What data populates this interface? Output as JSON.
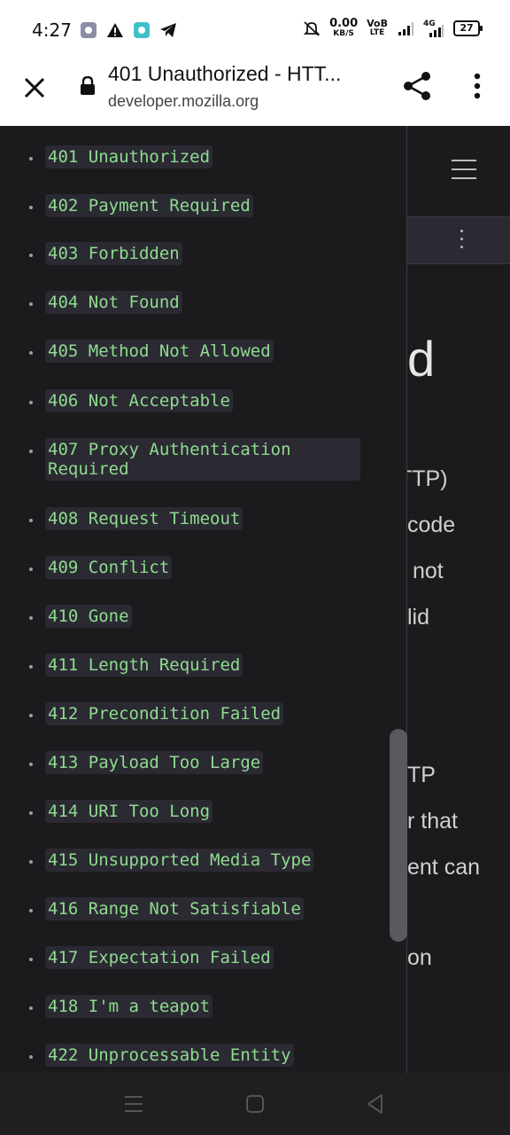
{
  "status_bar": {
    "time": "4:27",
    "net_speed_value": "0.00",
    "net_speed_unit": "KB/S",
    "volte_top": "VoB",
    "volte_bottom": "LTE",
    "network_label": "4G",
    "battery_level": "27",
    "left_icons": [
      "app-icon",
      "warning-icon",
      "app-icon",
      "telegram-icon"
    ],
    "right_icons": [
      "mute-icon",
      "signal-icon",
      "signal-icon"
    ]
  },
  "toolbar": {
    "title": "401 Unauthorized - HTT...",
    "url": "developer.mozilla.org"
  },
  "sidebar": {
    "items": [
      {
        "label": "401 Unauthorized"
      },
      {
        "label": "402 Payment Required"
      },
      {
        "label": "403 Forbidden"
      },
      {
        "label": "404 Not Found"
      },
      {
        "label": "405 Method Not Allowed"
      },
      {
        "label": "406 Not Acceptable"
      },
      {
        "label": "407 Proxy Authentication Required"
      },
      {
        "label": "408 Request Timeout"
      },
      {
        "label": "409 Conflict"
      },
      {
        "label": "410 Gone"
      },
      {
        "label": "411 Length Required"
      },
      {
        "label": "412 Precondition Failed"
      },
      {
        "label": "413 Payload Too Large"
      },
      {
        "label": "414 URI Too Long"
      },
      {
        "label": "415 Unsupported Media Type"
      },
      {
        "label": "416 Range Not Satisfiable"
      },
      {
        "label": "417 Expectation Failed"
      },
      {
        "label": "418 I'm a teapot"
      },
      {
        "label": "422 Unprocessable Entity"
      }
    ]
  },
  "background_page": {
    "fragments": [
      "d",
      "TTP)",
      "code",
      "not",
      "lid",
      "TP",
      "r that",
      "ent can",
      "on"
    ]
  },
  "colors": {
    "chip_text": "#8fdb8f",
    "chip_bg": "#2b2a33",
    "page_bg": "#1b1b1d"
  }
}
